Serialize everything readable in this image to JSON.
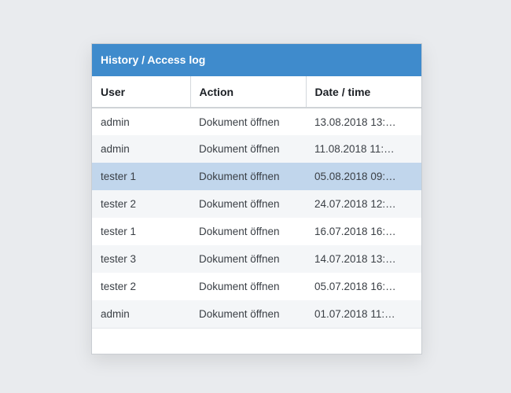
{
  "panel": {
    "title": "History / Access log"
  },
  "table": {
    "columns": [
      "User",
      "Action",
      "Date / time"
    ],
    "selected_row": 2,
    "rows": [
      {
        "user": "admin",
        "action": "Dokument öffnen",
        "datetime": "13.08.2018 13:…"
      },
      {
        "user": "admin",
        "action": "Dokument öffnen",
        "datetime": "11.08.2018 11:…"
      },
      {
        "user": "tester 1",
        "action": "Dokument öffnen",
        "datetime": "05.08.2018 09:…"
      },
      {
        "user": "tester 2",
        "action": "Dokument öffnen",
        "datetime": "24.07.2018 12:…"
      },
      {
        "user": "tester 1",
        "action": "Dokument öffnen",
        "datetime": "16.07.2018 16:…"
      },
      {
        "user": "tester 3",
        "action": "Dokument öffnen",
        "datetime": "14.07.2018 13:…"
      },
      {
        "user": "tester 2",
        "action": "Dokument öffnen",
        "datetime": "05.07.2018 16:…"
      },
      {
        "user": "admin",
        "action": "Dokument öffnen",
        "datetime": "01.07.2018 11:…"
      }
    ]
  },
  "colors": {
    "header_bar": "#3f8bcc",
    "selected_row": "#c1d6ec",
    "alt_row": "#f4f6f8"
  }
}
